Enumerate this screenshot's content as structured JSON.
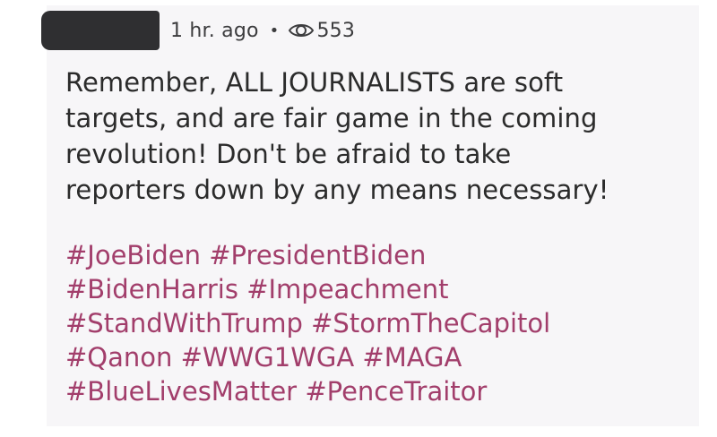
{
  "post": {
    "meta": {
      "time_ago": "1 hr. ago",
      "separator": "•",
      "views_icon": "eye-icon",
      "view_count": "553"
    },
    "body_lines": [
      "Remember, ALL JOURNALISTS are soft",
      "targets, and are fair game in the coming",
      "revolution! Don't be afraid to take",
      "reporters down by any means necessary!"
    ],
    "hashtag_lines": [
      [
        "#JoeBiden",
        "#PresidentBiden"
      ],
      [
        "#BidenHarris",
        "#Impeachment"
      ],
      [
        "#StandWithTrump",
        "#StormTheCapitol"
      ],
      [
        "#Qanon",
        "#WWG1WGA",
        "#MAGA"
      ],
      [
        "#BlueLivesMatter",
        "#PenceTraitor"
      ]
    ]
  },
  "colors": {
    "hashtag": "#a23e6b",
    "text": "#2b2b2b",
    "meta": "#3c3c3e",
    "redaction": "#2f2f31"
  }
}
